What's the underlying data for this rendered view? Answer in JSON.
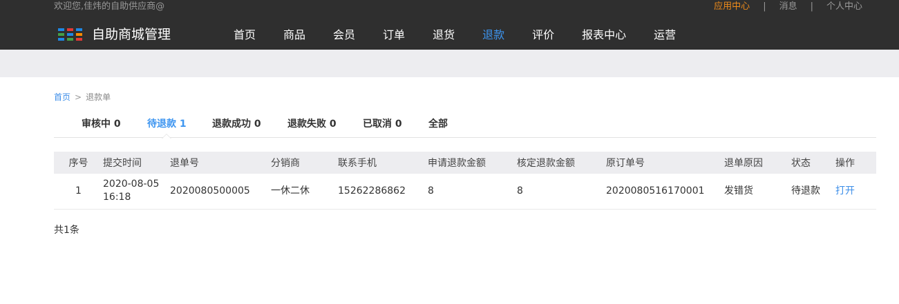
{
  "header": {
    "welcome": "欢迎您,佳炜的自助供应商@",
    "links": [
      {
        "label": "应用中心",
        "active": true
      },
      {
        "label": "消息",
        "active": false
      },
      {
        "label": "个人中心",
        "active": false
      }
    ],
    "separator": "|",
    "logo": {
      "icon": "grid-logo-icon",
      "text": "自助商城管理",
      "colors": [
        "#1e88e5",
        "#e53935",
        "#1e88e5",
        "#43a047",
        "#1e88e5",
        "#fb8c00",
        "#1e88e5",
        "#43a047",
        "#e53935"
      ]
    },
    "nav": [
      {
        "label": "首页",
        "active": false
      },
      {
        "label": "商品",
        "active": false
      },
      {
        "label": "会员",
        "active": false
      },
      {
        "label": "订单",
        "active": false
      },
      {
        "label": "退货",
        "active": false
      },
      {
        "label": "退款",
        "active": true
      },
      {
        "label": "评价",
        "active": false
      },
      {
        "label": "报表中心",
        "active": false
      },
      {
        "label": "运营",
        "active": false
      }
    ]
  },
  "breadcrumb": {
    "home": "首页",
    "arrow": ">",
    "current": "退款单"
  },
  "tabs": [
    {
      "label": "审核中",
      "count": "0",
      "active": false
    },
    {
      "label": "待退款",
      "count": "1",
      "active": true
    },
    {
      "label": "退款成功",
      "count": "0",
      "active": false
    },
    {
      "label": "退款失败",
      "count": "0",
      "active": false
    },
    {
      "label": "已取消",
      "count": "0",
      "active": false
    },
    {
      "label": "全部",
      "count": "",
      "active": false
    }
  ],
  "table": {
    "columns": [
      "序号",
      "提交时间",
      "退单号",
      "分销商",
      "联系手机",
      "申请退款金额",
      "核定退款金额",
      "原订单号",
      "退单原因",
      "状态",
      "操作"
    ],
    "rows": [
      {
        "no": "1",
        "date": "2020-08-05",
        "time": "16:18",
        "refund_no": "2020080500005",
        "distributor": "一休二休",
        "phone": "15262286862",
        "apply_amount": "8",
        "approved_amount": "8",
        "order_no": "2020080516170001",
        "reason": "发错货",
        "status": "待退款",
        "action": "打开"
      }
    ]
  },
  "total": "共1条",
  "colors": {
    "accent": "#3d95f0",
    "orange": "#f08c1a",
    "topbar": "#2f2f2f"
  }
}
